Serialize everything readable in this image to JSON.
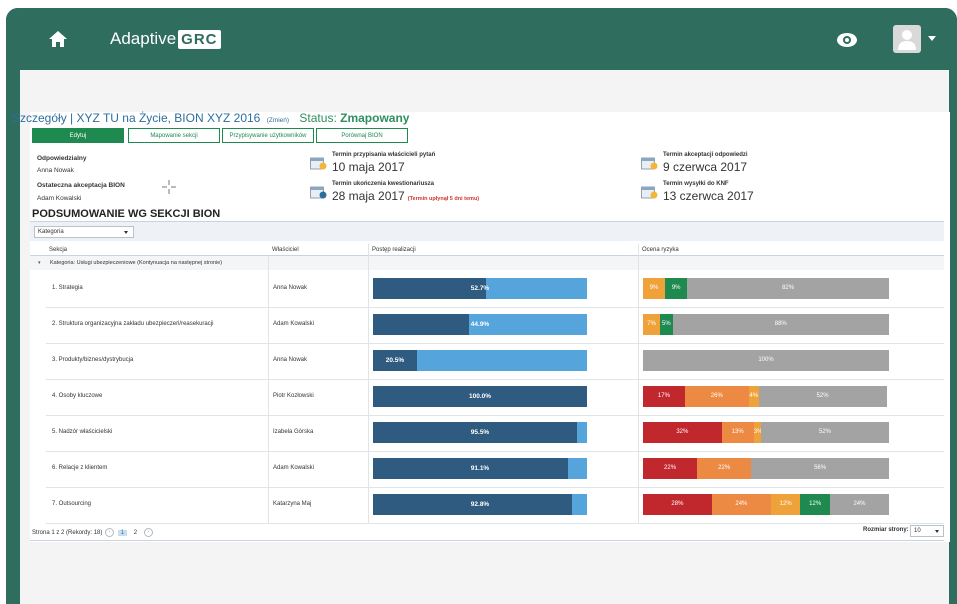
{
  "app": {
    "logo_text": "Adaptive",
    "logo_badge": "GRC"
  },
  "header": {
    "crumb_prefix": "Szczegóły",
    "crumb_title": "XYZ TU na Życie, BION XYZ 2016",
    "change_link": "(Zmień)",
    "status_label": "Status:",
    "status_value": "Zmapowany"
  },
  "tabs": [
    "Edytuj",
    "Mapowanie sekcji",
    "Przypisywanie użytkowników",
    "Porównaj BION"
  ],
  "fields": {
    "responsible_label": "Odpowiedzialny",
    "responsible_value": "Anna Nowak",
    "final_accept_label": "Ostateczna akceptacja BION",
    "final_accept_value": "Adam Kowalski"
  },
  "terms": [
    {
      "label": "Termin przypisania właścicieli pytań",
      "value": "10 maja 2017",
      "note": ""
    },
    {
      "label": "Termin ukończenia kwestionariusza",
      "value": "28 maja 2017",
      "note": "(Termin upłynął 5 dni temu)"
    },
    {
      "label": "Termin akceptacji odpowiedzi",
      "value": "9 czerwca 2017",
      "note": ""
    },
    {
      "label": "Termin wysyłki do KNF",
      "value": "13 czerwca 2017",
      "note": ""
    }
  ],
  "summary": {
    "title": "PODSUMOWANIE WG SEKCJI BION",
    "group_dropdown": "Kategoria",
    "columns": [
      "Sekcja",
      "Właściciel",
      "Postęp realizacji",
      "Ocena ryzyka"
    ],
    "group_label": "Kategoria: Usługi ubezpieczeniowe (Kontynuacja na następnej stronie)",
    "rows": [
      {
        "section": "1. Strategia",
        "owner": "Anna Nowak",
        "progress": 52.7,
        "progress_label": "52.7%",
        "risk": [
          {
            "v": 9,
            "c": "#f0a23a",
            "label": "9%"
          },
          {
            "v": 9,
            "c": "#1e8a4f",
            "label": "9%"
          },
          {
            "v": 82,
            "c": "#a3a3a3",
            "label": "82%"
          }
        ]
      },
      {
        "section": "2. Struktura organizacyjna zakładu ubezpieczeń/reasekuracji",
        "owner": "Adam Kowalski",
        "progress": 44.9,
        "progress_label": "44.9%",
        "risk": [
          {
            "v": 7,
            "c": "#f0a23a",
            "label": "7%"
          },
          {
            "v": 5,
            "c": "#1e8a4f",
            "label": "5%"
          },
          {
            "v": 88,
            "c": "#a3a3a3",
            "label": "88%"
          }
        ]
      },
      {
        "section": "3. Produkty/biznes/dystrybucja",
        "owner": "Anna Nowak",
        "progress": 20.5,
        "progress_label": "20.5%",
        "risk": [
          {
            "v": 100,
            "c": "#a3a3a3",
            "label": "100%"
          }
        ]
      },
      {
        "section": "4. Osoby kluczowe",
        "owner": "Piotr Kozłowski",
        "progress": 100.0,
        "progress_label": "100.0%",
        "risk": [
          {
            "v": 17,
            "c": "#c0282d",
            "label": "17%"
          },
          {
            "v": 26,
            "c": "#ec8a43",
            "label": "26%"
          },
          {
            "v": 4,
            "c": "#f0a23a",
            "label": "4%"
          },
          {
            "v": 52,
            "c": "#a3a3a3",
            "label": "52%"
          }
        ]
      },
      {
        "section": "5. Nadzór właścicielski",
        "owner": "Izabela Górska",
        "progress": 95.5,
        "progress_label": "95.5%",
        "risk": [
          {
            "v": 32,
            "c": "#c0282d",
            "label": "32%"
          },
          {
            "v": 13,
            "c": "#ec8a43",
            "label": "13%"
          },
          {
            "v": 3,
            "c": "#f0a23a",
            "label": "3%"
          },
          {
            "v": 52,
            "c": "#a3a3a3",
            "label": "52%"
          }
        ]
      },
      {
        "section": "6. Relacje z klientem",
        "owner": "Adam Kowalski",
        "progress": 91.1,
        "progress_label": "91.1%",
        "risk": [
          {
            "v": 22,
            "c": "#c0282d",
            "label": "22%"
          },
          {
            "v": 22,
            "c": "#ec8a43",
            "label": "22%"
          },
          {
            "v": 56,
            "c": "#a3a3a3",
            "label": "56%"
          }
        ]
      },
      {
        "section": "7. Outsourcing",
        "owner": "Katarzyna Maj",
        "progress": 92.8,
        "progress_label": "92.8%",
        "risk": [
          {
            "v": 28,
            "c": "#c0282d",
            "label": "28%"
          },
          {
            "v": 24,
            "c": "#ec8a43",
            "label": "24%"
          },
          {
            "v": 12,
            "c": "#f0a23a",
            "label": "12%"
          },
          {
            "v": 12,
            "c": "#1e8a4f",
            "label": "12%"
          },
          {
            "v": 24,
            "c": "#a3a3a3",
            "label": "24%"
          }
        ]
      }
    ]
  },
  "pager": {
    "info": "Strona 1 z 2 (Rekordy: 18)",
    "pages": [
      "1",
      "2"
    ],
    "page_size_label": "Rozmiar strony:",
    "page_size": "10"
  },
  "icons": [
    "home-icon",
    "eye-icon",
    "user-icon",
    "calendar-icon",
    "crosshair-icon"
  ]
}
